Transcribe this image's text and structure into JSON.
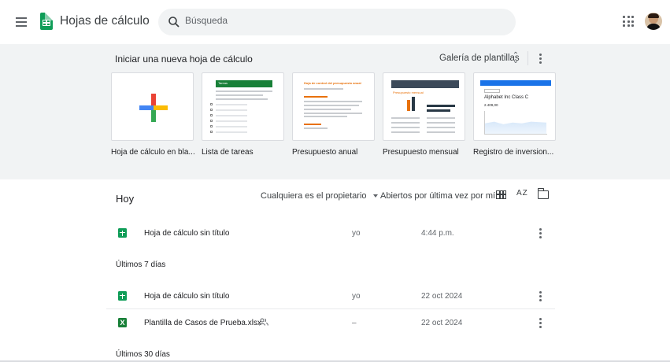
{
  "header": {
    "app_title": "Hojas de cálculo",
    "search_placeholder": "Búsqueda"
  },
  "gallery": {
    "title": "Iniciar una nueva hoja de cálculo",
    "link_label": "Galería de plantillas",
    "templates": [
      {
        "label": "Hoja de cálculo en bla...",
        "kind": "blank"
      },
      {
        "label": "Lista de tareas",
        "kind": "todo",
        "thumb_title": "Tareas"
      },
      {
        "label": "Presupuesto anual",
        "kind": "annual",
        "thumb_title": "Hoja de control del presupuesto anual"
      },
      {
        "label": "Presupuesto mensual",
        "kind": "monthly",
        "thumb_title": "Presupuesto mensual"
      },
      {
        "label": "Registro de inversion...",
        "kind": "investment",
        "thumb_title": "Alphabet Inc Class C",
        "thumb_value": "2.409,00"
      }
    ]
  },
  "files": {
    "header_title": "Hoy",
    "owner_filter": "Cualquiera es el propietario",
    "sort_label": "Abiertos por última vez por mí",
    "sort_az_label": "AZ",
    "sections": [
      {
        "label": "",
        "rows": [
          {
            "name": "Hoja de cálculo sin título",
            "type": "sheet",
            "owner": "yo",
            "date": "4:44 p.m.",
            "shared": false
          }
        ]
      },
      {
        "label": "Últimos 7 días",
        "rows": [
          {
            "name": "Hoja de cálculo sin título",
            "type": "sheet",
            "owner": "yo",
            "date": "22 oct 2024",
            "shared": false
          },
          {
            "name": "Plantilla de Casos de Prueba.xlsx",
            "type": "xlsx",
            "owner": "–",
            "date": "22 oct 2024",
            "shared": true
          }
        ]
      },
      {
        "label": "Últimos 30 días",
        "rows": []
      }
    ]
  },
  "colors": {
    "sheets_green": "#0f9d58",
    "gallery_bg": "#f1f3f4",
    "xlsx_green": "#188038"
  },
  "icons": [
    "menu-icon",
    "sheets-logo-icon",
    "search-icon",
    "apps-grid-icon",
    "unfold-icon",
    "more-vert-icon",
    "grid-view-icon",
    "sort-az-icon",
    "folder-icon",
    "shared-people-icon"
  ]
}
